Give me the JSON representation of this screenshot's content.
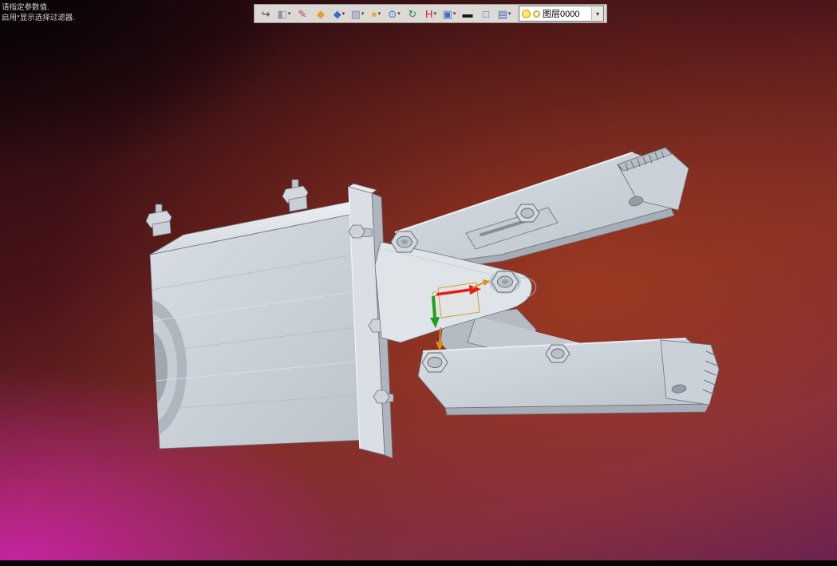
{
  "window": {
    "type": "cad-3d-viewport"
  },
  "status_hint": {
    "line1": "请指定参数值.",
    "line2": "启用*显示选择过滤器."
  },
  "toolbar": {
    "buttons": [
      {
        "name": "exit-button",
        "glyph": "↪",
        "color": "#3c4250",
        "dropdown": false
      },
      {
        "name": "selection-mode-button",
        "glyph": "◧",
        "color": "#8d95a5",
        "dropdown": true
      },
      {
        "name": "sketch-pen-button",
        "glyph": "✎",
        "color": "#c23a6a",
        "dropdown": false
      },
      {
        "name": "box-gold-button",
        "glyph": "◆",
        "color": "#d9a41e",
        "dropdown": false
      },
      {
        "name": "box-blue-button",
        "glyph": "◆",
        "color": "#3d6ec0",
        "dropdown": true
      },
      {
        "name": "cube-display-button",
        "glyph": "▧",
        "color": "#7e89b8",
        "dropdown": true
      },
      {
        "name": "material-sphere-button",
        "glyph": "●",
        "color": "#e2af1d",
        "dropdown": true
      },
      {
        "name": "zoom-button",
        "glyph": "⊙",
        "color": "#2e6fd2",
        "dropdown": true
      },
      {
        "name": "refresh-view-button",
        "glyph": "↻",
        "color": "#2e8f55",
        "dropdown": false
      },
      {
        "name": "h-display-button",
        "glyph": "H",
        "color": "#c62828",
        "dropdown": true
      },
      {
        "name": "screen-display-button",
        "glyph": "▣",
        "color": "#3d6ec0",
        "dropdown": true
      },
      {
        "name": "blackboard-button",
        "glyph": "▬",
        "color": "#151515",
        "dropdown": false
      },
      {
        "name": "frame-button",
        "glyph": "□",
        "color": "#3d6ec0",
        "dropdown": false
      },
      {
        "name": "layers-button",
        "glyph": "▤",
        "color": "#3d6ec0",
        "dropdown": true
      }
    ],
    "layer_combo": {
      "value": "图层0000"
    }
  },
  "model": {
    "label": "gripper-assembly",
    "triad": {
      "x_color": "#e01c1c",
      "y_color": "#1fa11f",
      "aux_color": "#e0891a"
    }
  }
}
